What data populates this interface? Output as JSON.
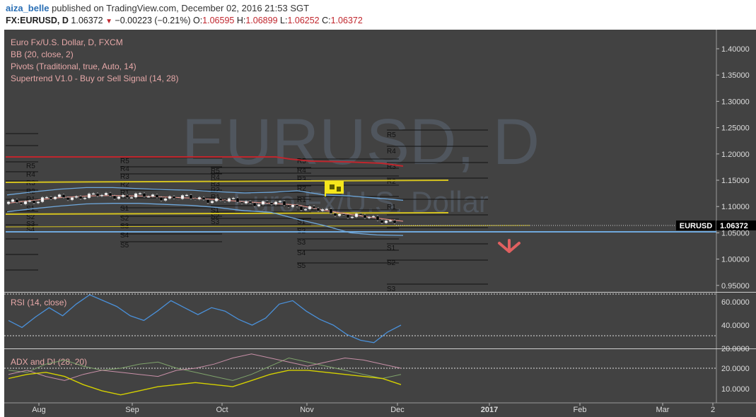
{
  "header": {
    "author": "aiza_belle",
    "published": "published on TradingView.com, December 02, 2016 21:53 SGT",
    "symbol": "FX:EURUSD, D",
    "last": "1.06372",
    "change": "−0.00223 (−0.21%)",
    "o_label": "O:",
    "o": "1.06595",
    "h_label": "H:",
    "h": "1.06899",
    "l_label": "L:",
    "l": "1.06252",
    "c_label": "C:",
    "c": "1.06372"
  },
  "legend": {
    "title": "Euro Fx/U.S. Dollar, D, FXCM",
    "bb": "BB (20, close, 2)",
    "pivots": "Pivots (Traditional, true, Auto, 14)",
    "supertrend": "Supertrend V1.0 - Buy or Sell Signal (14, 28)"
  },
  "watermark": {
    "main": "EURUSD, D",
    "sub": "Euro Fx/U.S. Dollar"
  },
  "price_tag": {
    "symbol": "EURUSD",
    "value": "1.06372"
  },
  "colors": {
    "background": "#424242",
    "candle_up": "#ffffff",
    "candle_down": "#000000",
    "bb_band": "#6fa8dc",
    "bb_basis": "#d98880",
    "rsi": "#4a90d9",
    "adx": "#d4d000",
    "di_plus": "#7fa36b",
    "di_minus": "#c990a8",
    "supertrend_red": "#c0262d",
    "supertrend_yellow": "#d4c21f",
    "support_blue": "#6fa8dc",
    "sell_arrow": "#e06060",
    "flag": "#f5e61c"
  },
  "chart_data": [
    {
      "type": "candlestick",
      "name": "EURUSD daily",
      "ylim": [
        0.94,
        1.41
      ],
      "yticks": [
        "1.40000",
        "1.35000",
        "1.30000",
        "1.25000",
        "1.20000",
        "1.15000",
        "1.10000",
        "1.05000",
        "1.00000",
        "0.95000"
      ],
      "xticks": [
        "Aug",
        "Sep",
        "Oct",
        "Nov",
        "Dec",
        "2017",
        "Feb",
        "Mar",
        "2"
      ],
      "series": [
        {
          "name": "BB upper",
          "values": [
            1.122,
            1.128,
            1.133,
            1.136,
            1.136,
            1.134,
            1.132,
            1.131,
            1.128,
            1.126,
            1.127,
            1.13,
            1.122,
            1.12,
            1.116,
            1.112
          ]
        },
        {
          "name": "BB lower",
          "values": [
            1.09,
            1.096,
            1.101,
            1.105,
            1.106,
            1.106,
            1.104,
            1.102,
            1.098,
            1.092,
            1.089,
            1.076,
            1.064,
            1.05,
            1.046,
            1.045
          ]
        },
        {
          "name": "BB basis",
          "values": [
            1.106,
            1.112,
            1.117,
            1.12,
            1.121,
            1.12,
            1.118,
            1.116,
            1.113,
            1.109,
            1.106,
            1.103,
            1.093,
            1.085,
            1.078,
            1.072
          ]
        }
      ],
      "pivot_labels": [
        "R5",
        "R4",
        "R3",
        "R2",
        "R1",
        "P",
        "S1",
        "S2",
        "S3",
        "S4",
        "S5"
      ]
    },
    {
      "type": "line",
      "name": "RSI (14, close)",
      "yticks": [
        "60.0000",
        "40.0000",
        "20.0000"
      ],
      "ylim": [
        18,
        70
      ],
      "values": [
        44,
        38,
        47,
        55,
        48,
        58,
        66,
        61,
        56,
        48,
        44,
        52,
        61,
        55,
        49,
        55,
        52,
        45,
        40,
        46,
        58,
        61,
        52,
        45,
        40,
        32,
        27,
        25,
        34,
        40
      ]
    },
    {
      "type": "line",
      "name": "ADX and DI (28, 20)",
      "yticks": [
        "20.0000",
        "10.0000"
      ],
      "ylim": [
        5,
        30
      ],
      "series": [
        {
          "name": "ADX",
          "values": [
            15,
            17,
            18,
            16,
            12,
            9,
            7,
            9,
            11,
            12,
            13,
            12,
            11,
            14,
            17,
            19,
            19,
            18,
            17,
            16,
            15,
            12
          ]
        },
        {
          "name": "+DI",
          "values": [
            19,
            18,
            22,
            24,
            21,
            19,
            20,
            22,
            23,
            20,
            18,
            16,
            14,
            17,
            21,
            25,
            23,
            21,
            19,
            17,
            15,
            17
          ]
        },
        {
          "name": "-DI",
          "values": [
            17,
            19,
            16,
            14,
            17,
            19,
            18,
            17,
            16,
            19,
            20,
            22,
            25,
            27,
            25,
            23,
            21,
            23,
            25,
            24,
            22,
            20
          ]
        }
      ]
    }
  ]
}
